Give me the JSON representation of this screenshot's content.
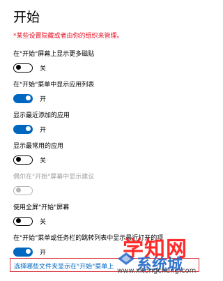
{
  "page": {
    "title": "开始",
    "warning": "*某些设置隐藏或者由你的组织来管理。"
  },
  "settings": [
    {
      "label": "在\"开始\"屏幕上显示更多磁贴",
      "state": "关"
    },
    {
      "label": "在\"开始\"菜单中显示应用列表",
      "state": "开"
    },
    {
      "label": "显示最近添加的应用",
      "state": "开"
    },
    {
      "label": "显示最常用的应用",
      "state": "关"
    },
    {
      "label": "偶尔在\"开始\"屏幕中显示建议",
      "state": ""
    },
    {
      "label": "使用全屏\"开始\"屏幕",
      "state": "关"
    },
    {
      "label": "在\"开始\"菜单或任务栏的跳转列表中显示最近打开的项",
      "state": "开"
    }
  ],
  "link": {
    "label": "选择哪些文件夹显示在\"开始\"菜单上"
  },
  "watermark": {
    "main": "学知网",
    "sub": "系统城",
    "url": "www.xitongcheng.com"
  },
  "colors": {
    "accent": "#0067c0",
    "warning": "#e81123",
    "highlight_box": "#d9363e",
    "disabled": "#a0a0a0"
  }
}
